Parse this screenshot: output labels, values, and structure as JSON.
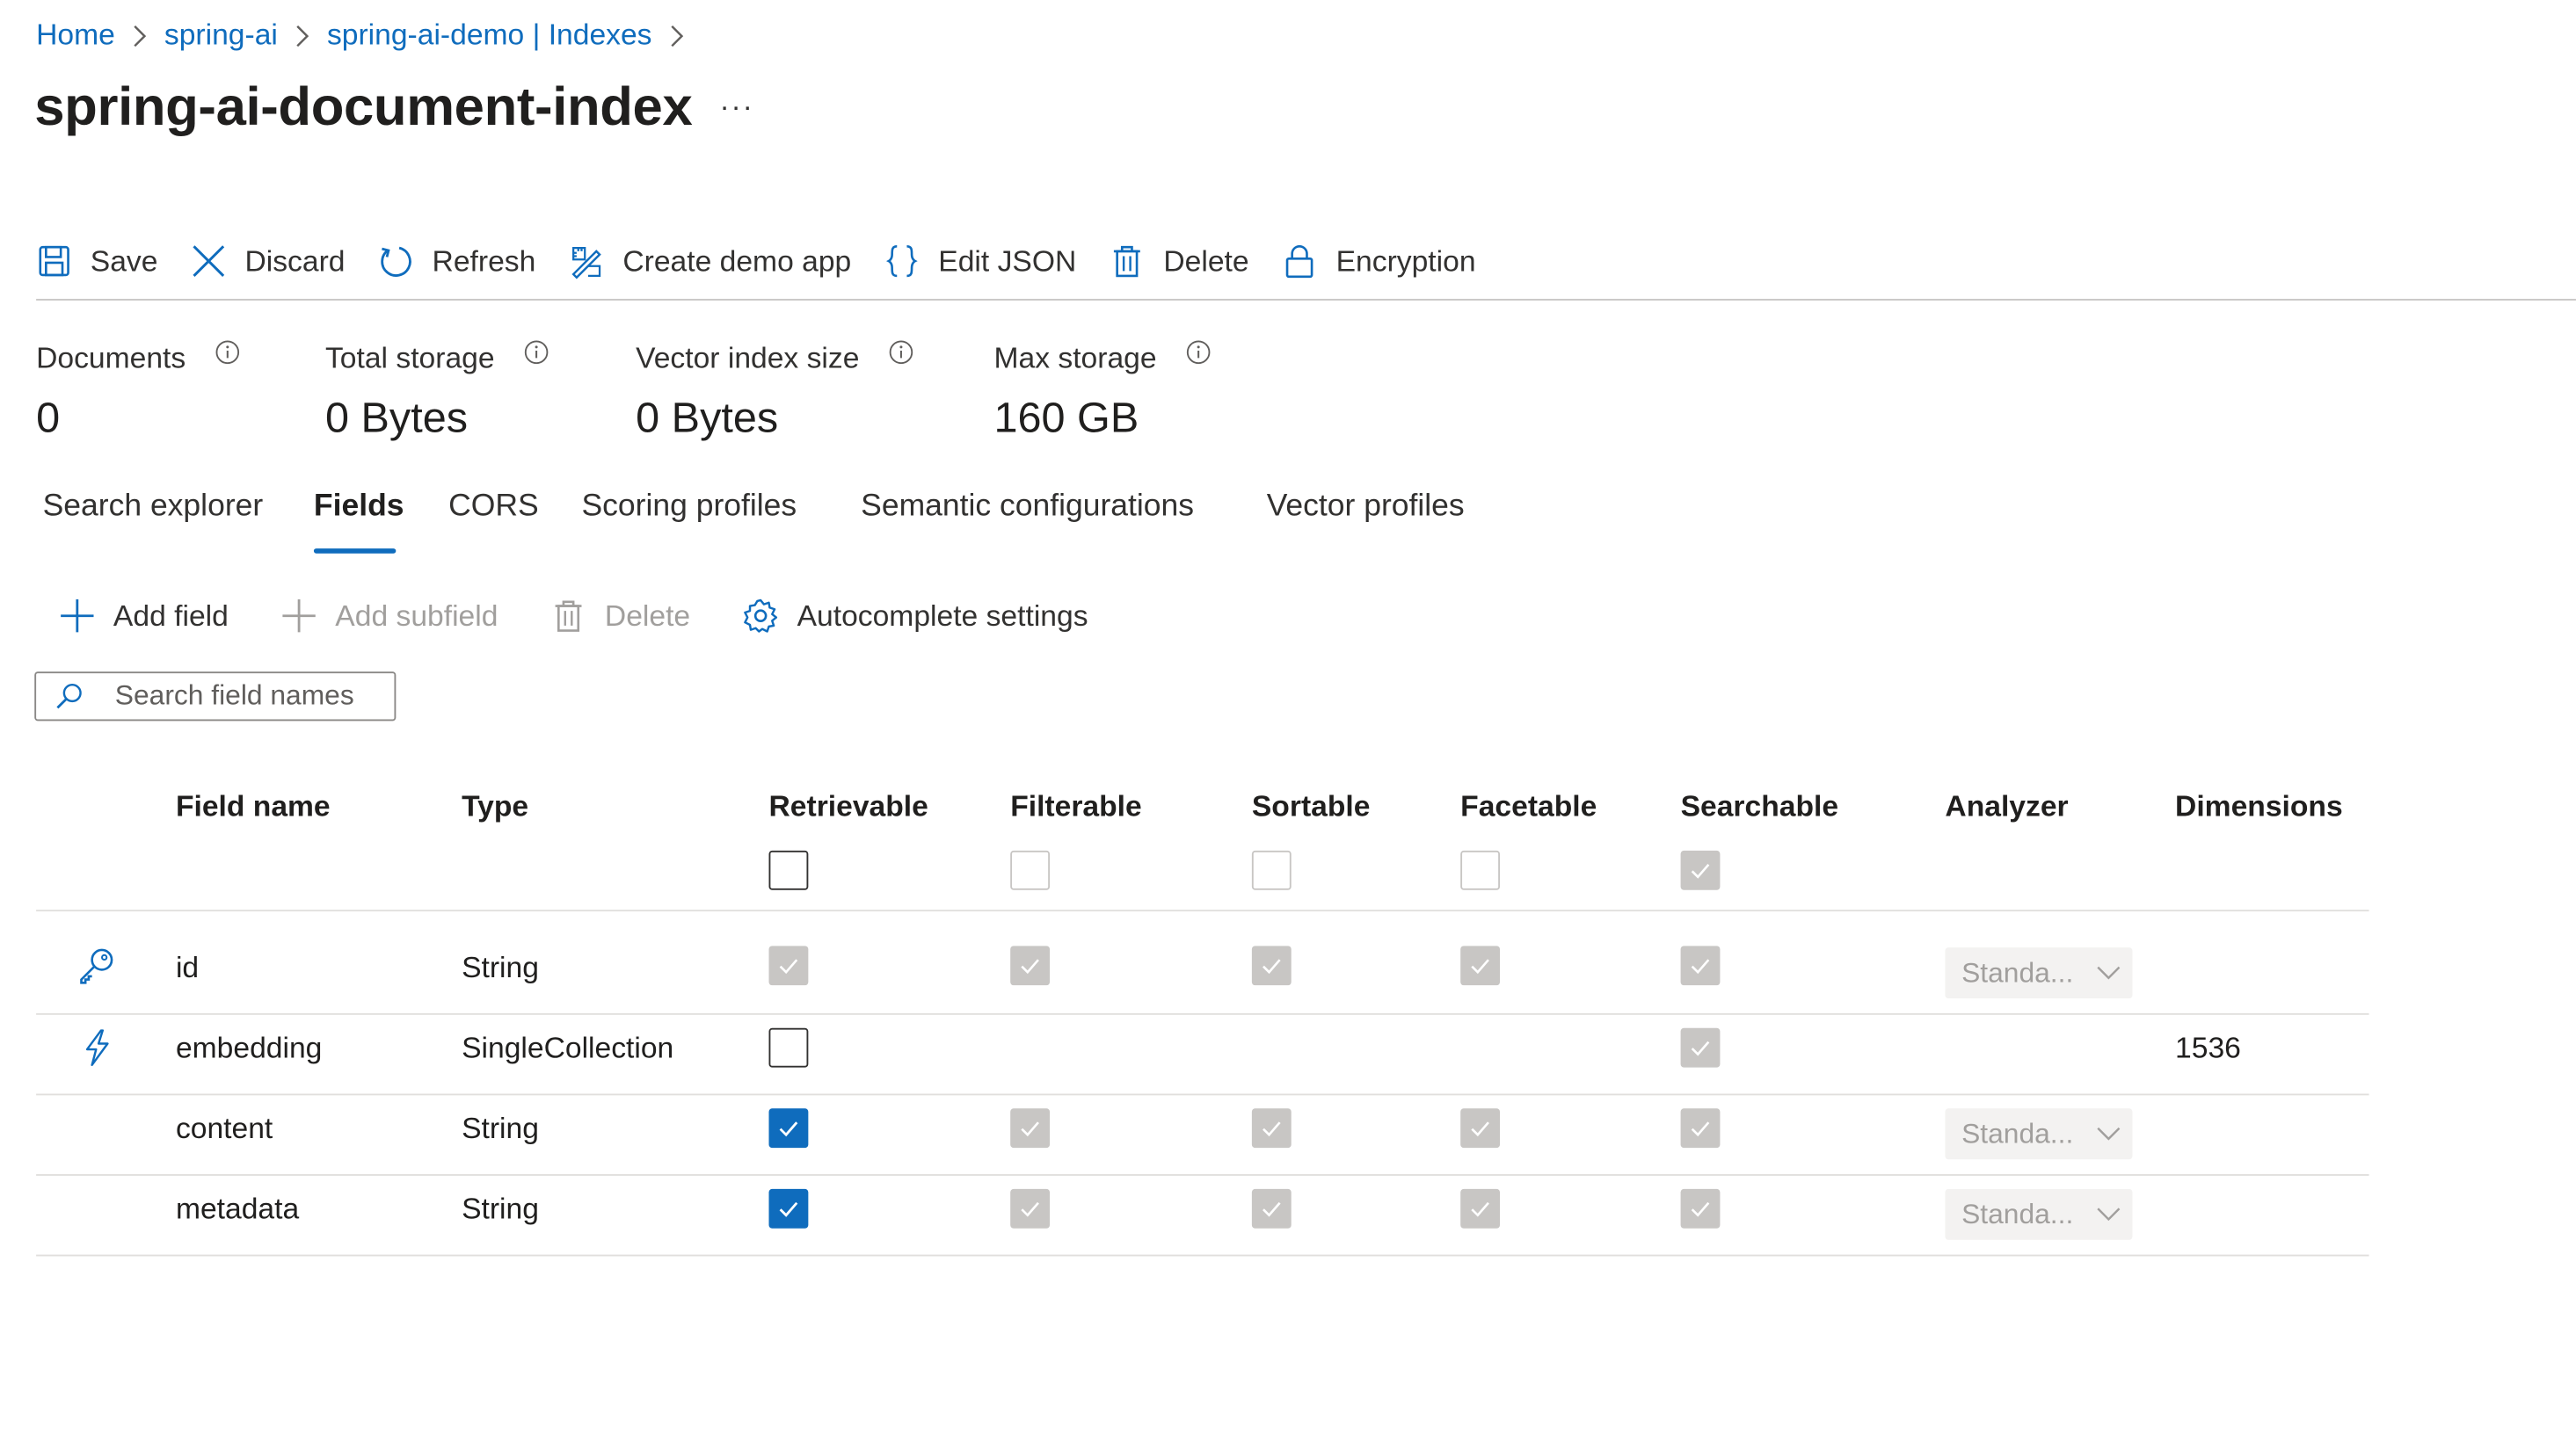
{
  "breadcrumb": [
    "Home",
    "spring-ai",
    "spring-ai-demo | Indexes"
  ],
  "title": "spring-ai-document-index",
  "more_label": "···",
  "command_bar": {
    "save": "Save",
    "discard": "Discard",
    "refresh": "Refresh",
    "create_demo_app": "Create demo app",
    "edit_json": "Edit JSON",
    "delete": "Delete",
    "encryption": "Encryption"
  },
  "stats": {
    "documents": {
      "label": "Documents",
      "value": "0"
    },
    "total_storage": {
      "label": "Total storage",
      "value": "0 Bytes"
    },
    "vector_index_size": {
      "label": "Vector index size",
      "value": "0 Bytes"
    },
    "max_storage": {
      "label": "Max storage",
      "value": "160 GB"
    }
  },
  "tabs": {
    "items": [
      "Search explorer",
      "Fields",
      "CORS",
      "Scoring profiles",
      "Semantic configurations",
      "Vector profiles"
    ],
    "active": "Fields"
  },
  "field_toolbar": {
    "add_field": "Add field",
    "add_subfield": "Add subfield",
    "delete": "Delete",
    "autocomplete_settings": "Autocomplete settings"
  },
  "search": {
    "placeholder": "Search field names"
  },
  "table": {
    "columns": [
      "Field name",
      "Type",
      "Retrievable",
      "Filterable",
      "Sortable",
      "Facetable",
      "Searchable",
      "Analyzer",
      "Dimensions"
    ],
    "header_checkboxes": {
      "retrievable": "unchecked",
      "filterable": "unchecked-disabled",
      "sortable": "unchecked-disabled",
      "facetable": "unchecked-disabled",
      "searchable": "checked-disabled"
    },
    "rows": [
      {
        "icon": "key-icon",
        "name": "id",
        "type": "String",
        "retrievable": "checked-disabled",
        "filterable": "checked-disabled",
        "sortable": "checked-disabled",
        "facetable": "checked-disabled",
        "searchable": "checked-disabled",
        "analyzer": "Standa...",
        "dimensions": ""
      },
      {
        "icon": "lightning-icon",
        "name": "embedding",
        "type": "SingleCollection",
        "retrievable": "unchecked",
        "filterable": "",
        "sortable": "",
        "facetable": "",
        "searchable": "checked-disabled",
        "analyzer": "",
        "dimensions": "1536"
      },
      {
        "icon": "",
        "name": "content",
        "type": "String",
        "retrievable": "checked",
        "filterable": "checked-disabled",
        "sortable": "checked-disabled",
        "facetable": "checked-disabled",
        "searchable": "checked-disabled",
        "analyzer": "Standa...",
        "dimensions": ""
      },
      {
        "icon": "",
        "name": "metadata",
        "type": "String",
        "retrievable": "checked",
        "filterable": "checked-disabled",
        "sortable": "checked-disabled",
        "facetable": "checked-disabled",
        "searchable": "checked-disabled",
        "analyzer": "Standa...",
        "dimensions": ""
      }
    ]
  },
  "colors": {
    "accent": "#0f6cbd",
    "text": "#323130",
    "disabled": "#c8c6c4"
  }
}
